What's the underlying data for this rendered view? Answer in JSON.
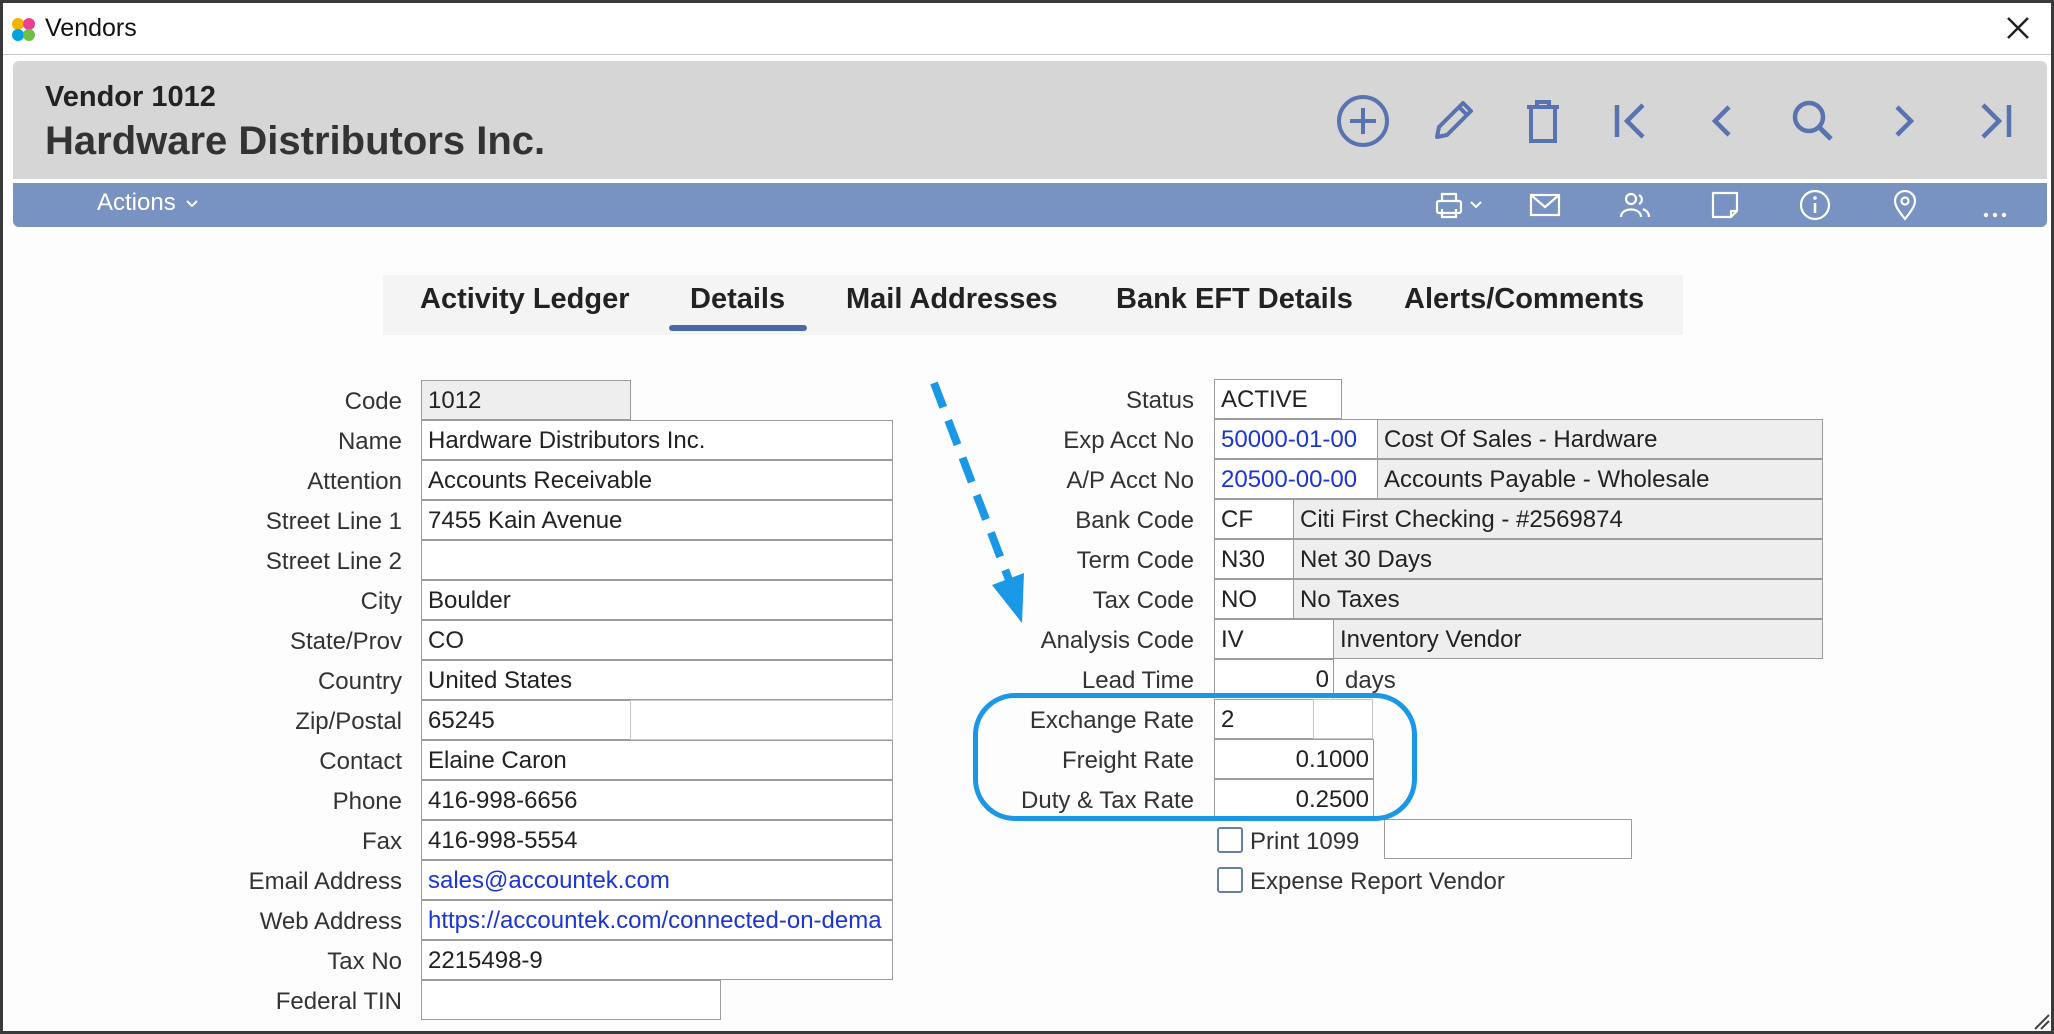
{
  "window": {
    "title": "Vendors"
  },
  "header": {
    "vendor_number": "Vendor 1012",
    "vendor_name": "Hardware Distributors Inc."
  },
  "nav_icons": [
    "add-icon",
    "edit-icon",
    "delete-icon",
    "first-record-icon",
    "previous-record-icon",
    "search-icon",
    "next-record-icon",
    "last-record-icon"
  ],
  "actionbar": {
    "actions_label": "Actions",
    "icons": [
      "printer-icon",
      "email-icon",
      "contacts-icon",
      "notes-icon",
      "info-icon",
      "location-icon",
      "more-icon"
    ]
  },
  "tabs": [
    {
      "label": "Activity Ledger"
    },
    {
      "label": "Details"
    },
    {
      "label": "Mail Addresses"
    },
    {
      "label": "Bank EFT Details"
    },
    {
      "label": "Alerts/Comments"
    }
  ],
  "active_tab": "Details",
  "left_fields": {
    "code": {
      "label": "Code",
      "value": "1012"
    },
    "name": {
      "label": "Name",
      "value": "Hardware Distributors Inc."
    },
    "attention": {
      "label": "Attention",
      "value": "Accounts Receivable"
    },
    "street1": {
      "label": "Street Line 1",
      "value": "7455 Kain Avenue"
    },
    "street2": {
      "label": "Street Line 2",
      "value": ""
    },
    "city": {
      "label": "City",
      "value": "Boulder"
    },
    "state": {
      "label": "State/Prov",
      "value": "CO"
    },
    "country": {
      "label": "Country",
      "value": "United States"
    },
    "zip": {
      "label": "Zip/Postal",
      "value": "65245"
    },
    "contact": {
      "label": "Contact",
      "value": "Elaine Caron"
    },
    "phone": {
      "label": "Phone",
      "value": "416-998-6656"
    },
    "fax": {
      "label": "Fax",
      "value": "416-998-5554"
    },
    "email": {
      "label": "Email Address",
      "value": "sales@accountek.com"
    },
    "web": {
      "label": "Web Address",
      "value": "https://accountek.com/connected-on-dema"
    },
    "taxno": {
      "label": "Tax No",
      "value": "2215498-9"
    },
    "tin": {
      "label": "Federal TIN",
      "value": ""
    }
  },
  "right_fields": {
    "status": {
      "label": "Status",
      "value": "ACTIVE"
    },
    "exp_acct": {
      "label": "Exp Acct No",
      "value": "50000-01-00",
      "desc": "Cost Of Sales - Hardware"
    },
    "ap_acct": {
      "label": "A/P Acct No",
      "value": "20500-00-00",
      "desc": "Accounts Payable - Wholesale"
    },
    "bank": {
      "label": "Bank Code",
      "value": "CF",
      "desc": "Citi First Checking - #2569874"
    },
    "term": {
      "label": "Term Code",
      "value": "N30",
      "desc": "Net 30 Days"
    },
    "tax": {
      "label": "Tax Code",
      "value": "NO",
      "desc": "No Taxes"
    },
    "analysis": {
      "label": "Analysis Code",
      "value": "IV",
      "desc": "Inventory Vendor"
    },
    "lead": {
      "label": "Lead Time",
      "value": "0",
      "unit": "days"
    },
    "exchange": {
      "label": "Exchange Rate",
      "value": "2"
    },
    "freight": {
      "label": "Freight Rate",
      "value": "0.1000"
    },
    "duty": {
      "label": "Duty & Tax Rate",
      "value": "0.2500"
    },
    "print1099": {
      "label": "Print 1099",
      "checked": false
    },
    "expense_vendor": {
      "label": "Expense Report Vendor",
      "checked": false
    }
  },
  "colors": {
    "header_bg": "#d6d6d6",
    "actionbar_bg": "#7892c2",
    "icon_blue": "#5873b0",
    "tab_underline": "#4a69a8",
    "link": "#1c35d6",
    "highlight": "#1a97e5"
  }
}
